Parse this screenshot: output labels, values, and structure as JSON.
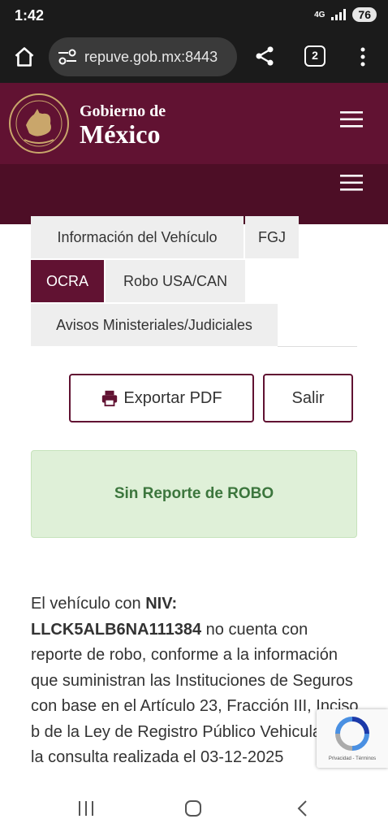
{
  "status": {
    "time": "1:42",
    "network": "4G",
    "battery": "76"
  },
  "browser": {
    "url": "repuve.gob.mx:8443",
    "tab_count": "2"
  },
  "header": {
    "line1": "Gobierno de",
    "line2": "México"
  },
  "tabs": [
    {
      "label": "Información del Vehículo",
      "active": false
    },
    {
      "label": "FGJ",
      "active": false
    },
    {
      "label": "OCRA",
      "active": true
    },
    {
      "label": "Robo USA/CAN",
      "active": false
    },
    {
      "label": "Avisos Ministeriales/Judiciales",
      "active": false
    }
  ],
  "actions": {
    "export_label": "Exportar PDF",
    "exit_label": "Salir"
  },
  "alert": {
    "text": "Sin Reporte de ROBO"
  },
  "result": {
    "prefix": "El vehículo con ",
    "niv_label": "NIV:",
    "niv_value": "LLCK5ALB6NA111384",
    "body": " no cuenta con reporte de robo, conforme a la información que suministran las Instituciones de Seguros con base en el Artículo 23, Fracción III, Inciso b de la Ley de Registro Público Vehicular, en la consulta realizada el 03-12-2025"
  },
  "recaptcha": {
    "privacy": "Privacidad",
    "separator": " - ",
    "terms": "Términos"
  },
  "colors": {
    "brand": "#611232",
    "brand_dark": "#4d0e26",
    "alert_bg": "#dff0d8",
    "alert_text": "#3c763d",
    "chrome": "#1b1b1b"
  },
  "icons": [
    "home-icon",
    "tune-icon",
    "share-icon",
    "more-vert-icon",
    "mexico-seal-icon",
    "hamburger-menu-icon",
    "printer-icon",
    "recaptcha-icon",
    "nav-recents-icon",
    "nav-home-icon",
    "nav-back-icon"
  ]
}
